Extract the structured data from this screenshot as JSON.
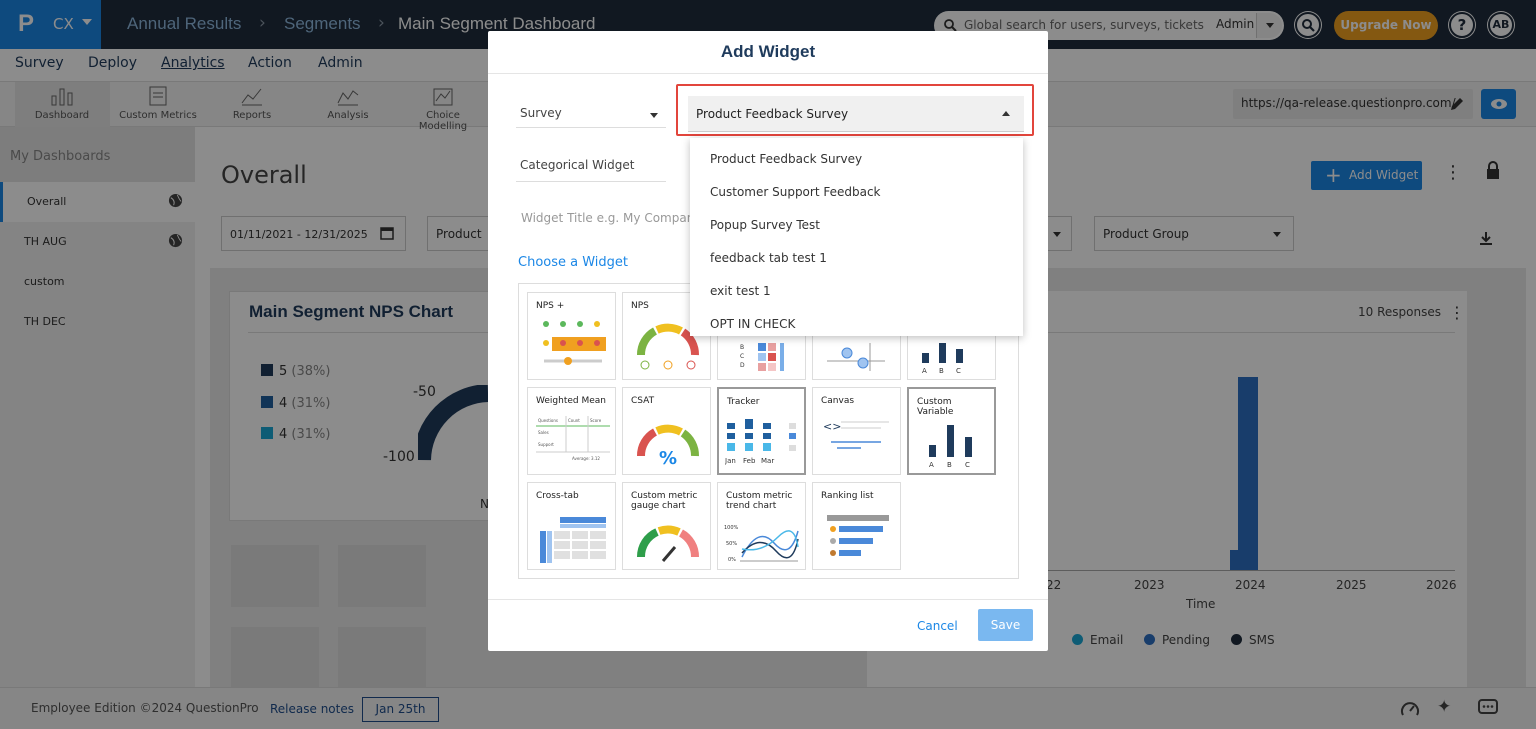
{
  "header": {
    "logo_letter": "P",
    "product": "CX",
    "breadcrumbs": [
      "Annual Results",
      "Segments",
      "Main Segment Dashboard"
    ],
    "search_placeholder": "Global search for users, surveys, tickets",
    "scope": "Admin",
    "upgrade": "Upgrade Now",
    "help": "?",
    "avatar": "AB"
  },
  "menu": [
    "Survey",
    "Deploy",
    "Analytics",
    "Action",
    "Admin"
  ],
  "toolbar": [
    "Dashboard",
    "Custom Metrics",
    "Reports",
    "Analysis",
    "Choice Modelling"
  ],
  "url": "https://qa-release.questionpro.com/",
  "sidebar": {
    "title": "My Dashboards",
    "items": [
      "Overall",
      "TH AUG",
      "custom",
      "TH DEC"
    ]
  },
  "main": {
    "title": "Overall",
    "date_range": "01/11/2021 - 12/31/2025",
    "product_filter": "Product",
    "product_group_filter": "Product Group",
    "add_widget": "Add Widget",
    "nps_card": {
      "title": "Main Segment NPS Chart",
      "legend": [
        {
          "label": "5",
          "pct": "(38%)",
          "color": "#1f3b5c"
        },
        {
          "label": "4",
          "pct": "(31%)",
          "color": "#1f5f9e"
        },
        {
          "label": "4",
          "pct": "(31%)",
          "color": "#1ba8d6"
        }
      ],
      "gauge_labels": [
        "-50",
        "-100"
      ],
      "bottom_letter": "N"
    },
    "right_card": {
      "responses": "10 Responses",
      "x_ticks": [
        "22",
        "2023",
        "2024",
        "2025",
        "2026"
      ],
      "x_title": "Time",
      "legend": [
        "Email",
        "Pending",
        "SMS"
      ]
    }
  },
  "footer": {
    "edition": "Employee Edition ©2024 QuestionPro",
    "release_notes": "Release notes",
    "release_date": "Jan 25th"
  },
  "modal": {
    "title": "Add Widget",
    "survey_label": "Survey",
    "selected_survey": "Product Feedback Survey",
    "widget_type": "Categorical Widget",
    "title_placeholder": "Widget Title e.g. My Company Be",
    "choose": "Choose a Widget",
    "options": [
      "Product Feedback Survey",
      "Customer Support Feedback",
      "Popup Survey Test",
      "feedback tab test 1",
      "exit test 1",
      "OPT IN CHECK"
    ],
    "tiles": [
      "NPS +",
      "NPS",
      "",
      "",
      "",
      "Weighted Mean",
      "CSAT",
      "Tracker",
      "Canvas",
      "Custom Variable",
      "Cross-tab",
      "Custom metric gauge chart",
      "Custom metric trend chart",
      "Ranking list"
    ],
    "cancel": "Cancel",
    "save": "Save"
  },
  "colors": {
    "accent": "#1b87e6",
    "dark": "#1f2d3d",
    "upgrade": "#f0a020",
    "highlight": "#e2453c"
  }
}
